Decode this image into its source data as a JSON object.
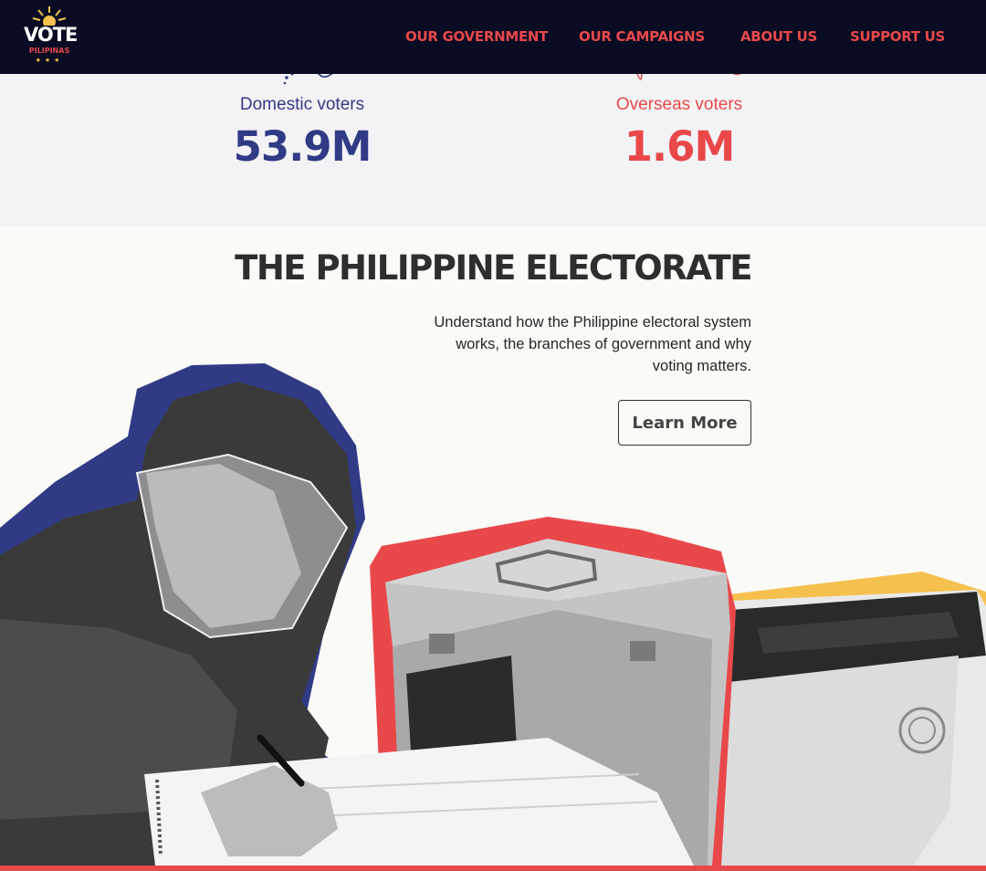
{
  "header": {
    "logo": {
      "line1": "VOTE",
      "line2": "PILIPINAS",
      "icon": "sun-icon"
    },
    "nav": [
      {
        "label": "OUR GOVERNMENT"
      },
      {
        "label": "OUR CAMPAIGNS"
      },
      {
        "label": "ABOUT US"
      },
      {
        "label": "SUPPORT US"
      }
    ]
  },
  "stats": {
    "domestic": {
      "label": "Domestic voters",
      "value": "53.9M",
      "color": "#313a85"
    },
    "overseas": {
      "label": "Overseas voters",
      "value": "1.6M",
      "color": "#e9484b"
    }
  },
  "electorate": {
    "title": "THE PHILIPPINE ELECTORATE",
    "description": "Understand how the Philippine electoral system works, the branches of government and why voting matters.",
    "cta_label": "Learn More"
  },
  "colors": {
    "nav_bg": "#090c23",
    "accent_red": "#e9484b",
    "accent_blue": "#313a85",
    "accent_yellow": "#f5c04d"
  }
}
